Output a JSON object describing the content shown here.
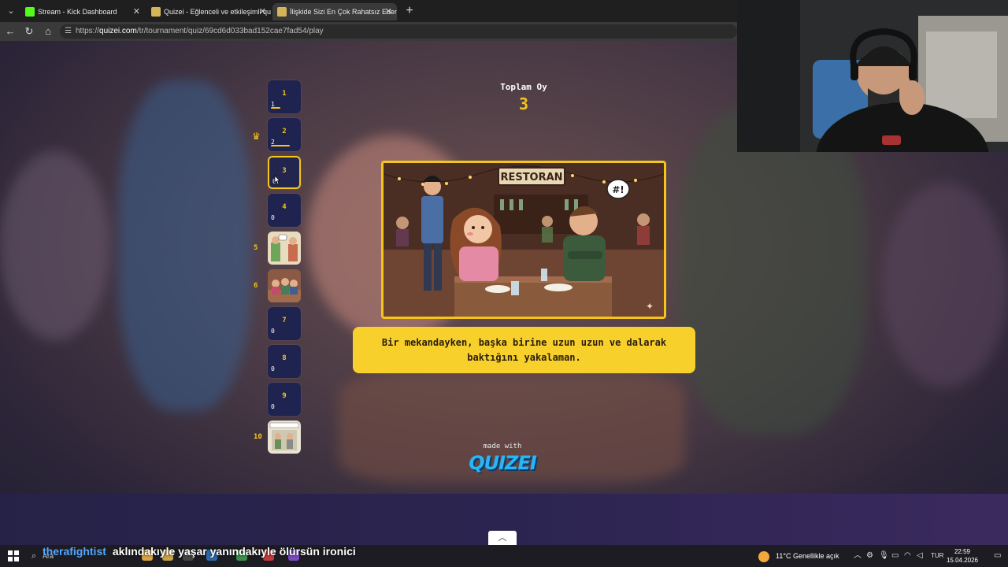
{
  "browser": {
    "tabs": [
      {
        "title": "Stream - Kick Dashboard",
        "favicon_color": "#53fc18",
        "active": false
      },
      {
        "title": "Quizei - Eğlenceli ve etkileşimli qu",
        "favicon_color": "#d6b45a",
        "active": false
      },
      {
        "title": "İlişkide Sizi En Çok Rahatsız Eden D",
        "favicon_color": "#d6b45a",
        "active": true
      }
    ],
    "url_prefix": "https://",
    "url_host": "quizei.com",
    "url_path": "/tr/tournament/quiz/69cd6d033bad152cae7fad54/play"
  },
  "quiz": {
    "vote_title": "Toplam Oy",
    "vote_count": "3",
    "question_text": "Bir mekandayken, başka birine uzun uzun ve dalarak baktığını yakalaman.",
    "image_sign": "RESTORAN",
    "image_bubble": "#!",
    "rounds": [
      {
        "num": "1",
        "votes": "1",
        "bar": 0.33
      },
      {
        "num": "2",
        "votes": "2",
        "bar": 0.67
      },
      {
        "num": "3",
        "votes": "0",
        "bar": 0
      },
      {
        "num": "4",
        "votes": "0",
        "bar": 0
      },
      {
        "num": "5",
        "thumb": true
      },
      {
        "num": "6",
        "thumb": true
      },
      {
        "num": "7",
        "votes": "0",
        "bar": 0
      },
      {
        "num": "8",
        "votes": "0",
        "bar": 0
      },
      {
        "num": "9",
        "votes": "0",
        "bar": 0
      },
      {
        "num": "10",
        "thumb": true
      }
    ],
    "made_with": "made with",
    "brand": "QUIZEI"
  },
  "taskbar": {
    "search_placeholder": "Ara",
    "chat_user": "therafightist",
    "chat_message": "aklındakıyle yaşar yanındakıyle ölürsün ironici",
    "weather": "11°C  Genellikle açık",
    "language": "TUR",
    "time": "22:59",
    "date": "15.04.2026"
  },
  "colors": {
    "accent": "#f5c518",
    "round_bg": "#1f2350",
    "question_bg": "#f8d02b",
    "brand": "#29b6f6"
  }
}
